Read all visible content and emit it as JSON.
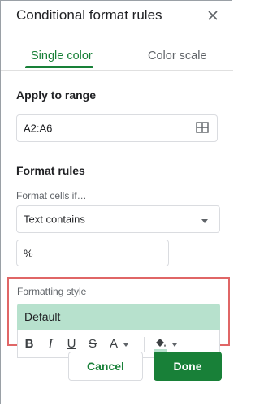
{
  "panel": {
    "title": "Conditional format rules"
  },
  "tabs": [
    {
      "label": "Single color",
      "active": true
    },
    {
      "label": "Color scale",
      "active": false
    }
  ],
  "range": {
    "label": "Apply to range",
    "value": "A2:A6"
  },
  "rules": {
    "label": "Format rules",
    "condition_label": "Format cells if…",
    "condition_value": "Text contains",
    "value_input": "%"
  },
  "formatting": {
    "label": "Formatting style",
    "preview_text": "Default",
    "preview_color": "#b7e1cd",
    "toolbar": {
      "bold": "B",
      "italic": "I",
      "underline": "U",
      "strikethrough": "S",
      "text_color": "A"
    }
  },
  "actions": {
    "cancel": "Cancel",
    "done": "Done"
  },
  "colors": {
    "accent": "#188038",
    "highlight_border": "#e06666"
  }
}
